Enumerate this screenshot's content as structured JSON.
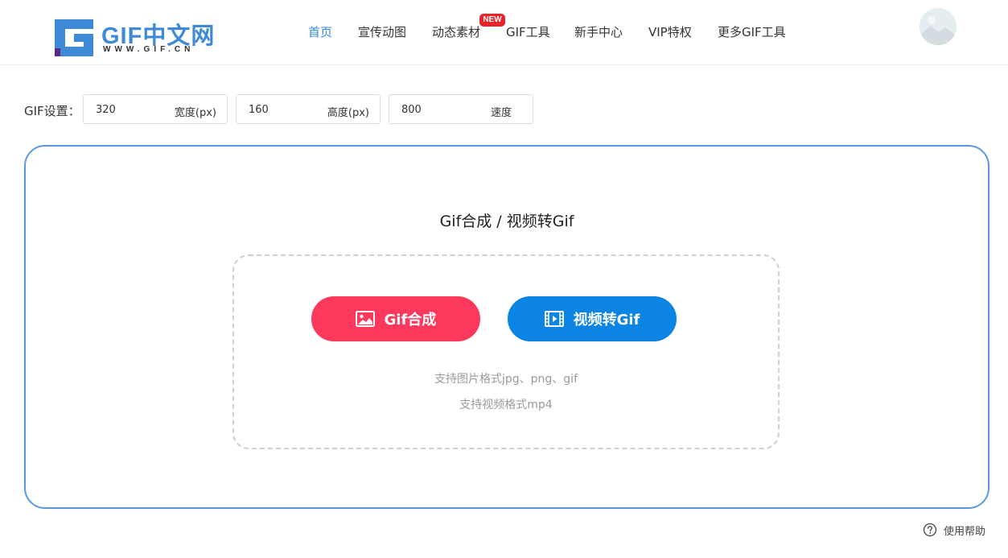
{
  "header": {
    "logo": {
      "text": "GIF中文网",
      "sub": "WWW.GIF.CN"
    },
    "nav": [
      {
        "label": "首页"
      },
      {
        "label": "宣传动图"
      },
      {
        "label": "动态素材"
      },
      {
        "label": "GIF工具"
      },
      {
        "label": "新手中心"
      },
      {
        "label": "VIP特权"
      },
      {
        "label": "更多GIF工具"
      }
    ],
    "new_badge": "NEW",
    "active_color": "#2f8ce0"
  },
  "settings": {
    "label": "GIF设置：",
    "width": {
      "value": "320",
      "unit": "宽度(px)"
    },
    "height": {
      "value": "160",
      "unit": "高度(px)"
    },
    "speed": {
      "value": "800",
      "unit": "速度"
    }
  },
  "main": {
    "title": "Gif合成 / 视频转Gif",
    "gif_button": "Gif合成",
    "video_button": "视频转Gif",
    "hint_image": "支持图片格式jpg、png、gif",
    "hint_video": "支持视频格式mp4",
    "colors": {
      "border": "#5a98e6",
      "gif_button": "#fc385c",
      "video_button": "#0c84e4"
    }
  },
  "help": {
    "label": "使用帮助",
    "icon": "question-circle-icon"
  }
}
